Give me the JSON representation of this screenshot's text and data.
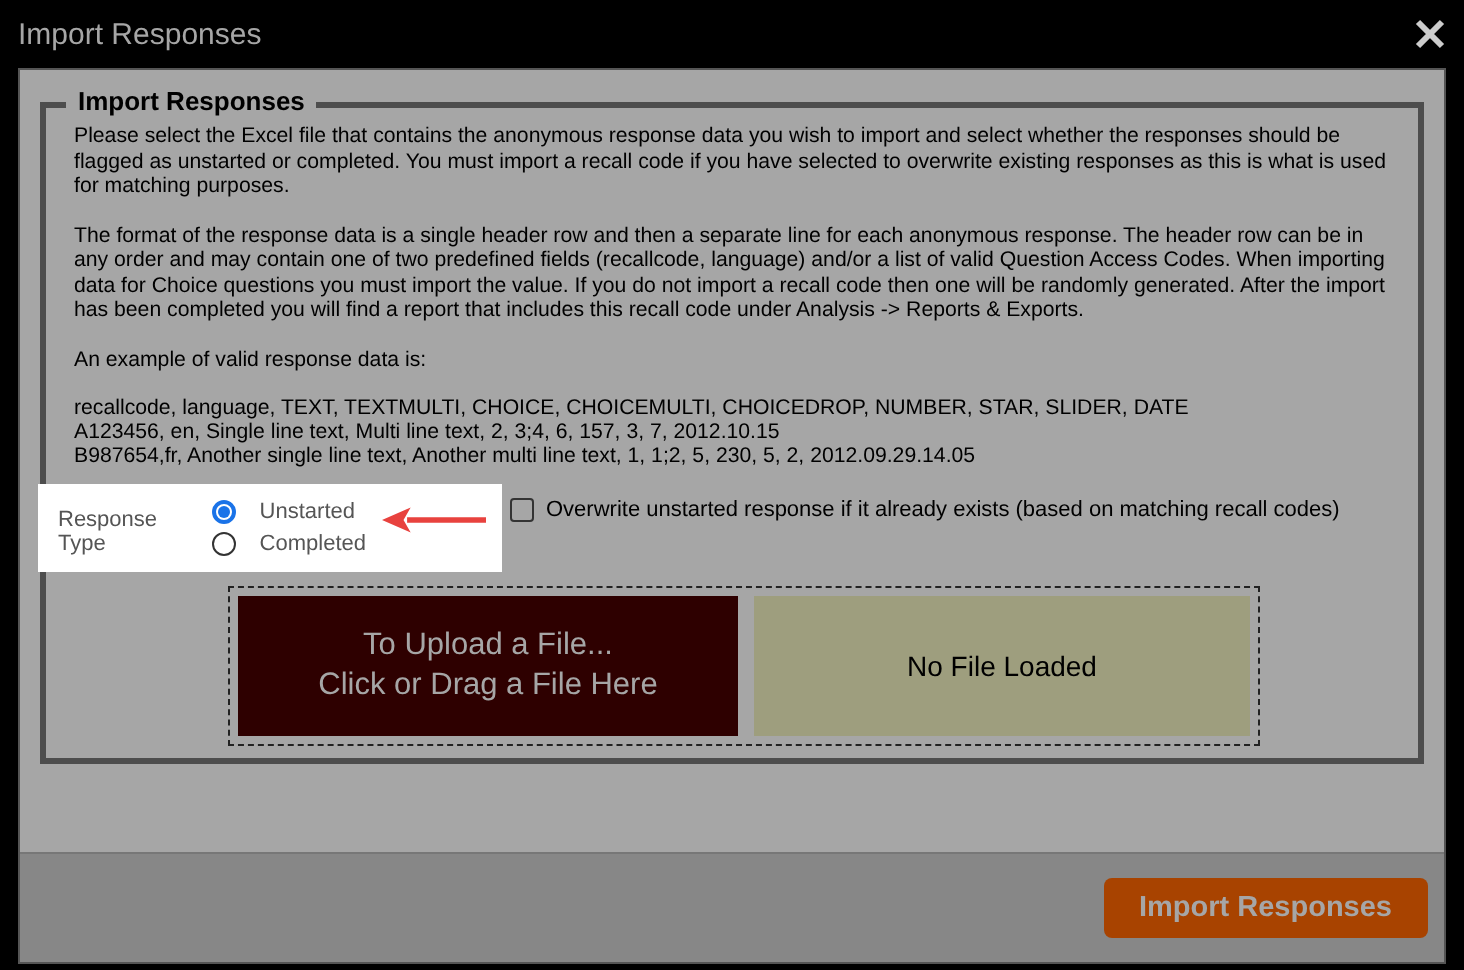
{
  "window": {
    "title": "Import Responses"
  },
  "section": {
    "title": "Import Responses",
    "paragraphs": [
      "Please select the Excel file that contains the anonymous response data you wish to import and select whether the responses should be flagged as unstarted or completed. You must import a recall code if you have selected to overwrite existing responses as this is what is used for matching purposes.",
      "The format of the response data is a single header row and then a separate line for each anonymous response. The header row can be in any order and may contain one of two predefined fields (recallcode, language) and/or a list of valid Question Access Codes. When importing data for Choice questions you must import the value. If you do not import a recall code then one will be randomly generated. After the import has been completed you will find a report that includes this recall code under Analysis -> Reports & Exports.",
      "An example of valid response data is:"
    ],
    "example_lines": [
      "recallcode, language, TEXT, TEXTMULTI, CHOICE, CHOICEMULTI, CHOICEDROP, NUMBER, STAR, SLIDER, DATE",
      "A123456, en, Single line text, Multi line text, 2, 3;4, 6, 157, 3, 7, 2012.10.15",
      "B987654,fr, Another single line text, Another multi line text, 1, 1;2, 5, 230, 5, 2, 2012.09.29.14.05"
    ]
  },
  "response_type": {
    "label": "Response Type",
    "options": [
      {
        "label": "Unstarted",
        "selected": true
      },
      {
        "label": "Completed",
        "selected": false
      }
    ]
  },
  "overwrite": {
    "label": "Overwrite unstarted response if it already exists (based on matching recall codes)",
    "checked": false
  },
  "upload": {
    "lines": [
      "To Upload a File...",
      "Click or Drag a File Here"
    ],
    "status": "No File Loaded"
  },
  "footer": {
    "button": "Import Responses"
  }
}
